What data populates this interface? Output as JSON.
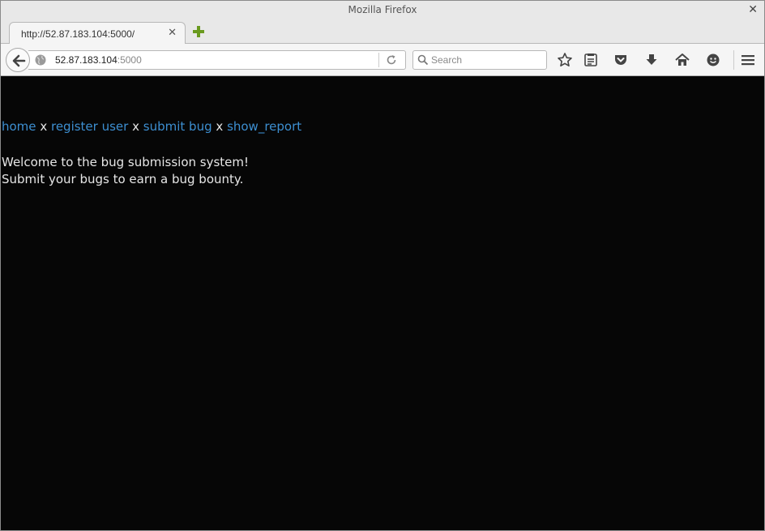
{
  "window": {
    "title": "Mozilla Firefox"
  },
  "tab": {
    "title": "http://52.87.183.104:5000/"
  },
  "urlbar": {
    "host": "52.87.183.104",
    "port": ":5000"
  },
  "search": {
    "placeholder": "Search"
  },
  "toolbar_icons": [
    "bookmark-star-icon",
    "reading-list-icon",
    "pocket-icon",
    "download-icon",
    "home-icon",
    "hello-icon",
    "menu-icon"
  ],
  "page": {
    "links": {
      "home": "home",
      "register": "register user",
      "submit": "submit bug",
      "report": "show_report"
    },
    "separator": "x",
    "message_line1": "Welcome to the bug submission system!",
    "message_line2": "Submit your bugs to earn a bug bounty."
  },
  "colors": {
    "page_bg": "#060606",
    "link": "#3d8fd1",
    "text": "#e6e6e6"
  }
}
